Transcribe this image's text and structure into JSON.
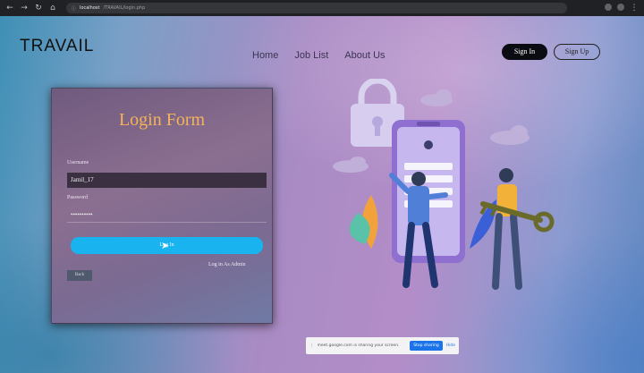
{
  "browser": {
    "url_host": "localhost",
    "url_path": "/TRAVAIL/login.php"
  },
  "header": {
    "logo": "TRAVAIL",
    "nav": [
      {
        "label": "Home"
      },
      {
        "label": "Job List"
      },
      {
        "label": "About Us"
      }
    ],
    "signin_label": "Sign In",
    "signup_label": "Sign Up"
  },
  "login": {
    "title": "Login Form",
    "username_label": "Username",
    "username_value": "Jamil_17",
    "password_label": "Password",
    "password_value": "••••••••••",
    "submit_label": "Log In",
    "admin_link": "Log in As Admin",
    "back_label": "Back"
  },
  "sharebar": {
    "message": "meet.google.com is sharing your screen.",
    "stop_label": "Stop sharing",
    "hide_label": "Hide"
  },
  "colors": {
    "title": "#f5b35a",
    "button": "#19b3ef",
    "card": "#7b6a92"
  }
}
